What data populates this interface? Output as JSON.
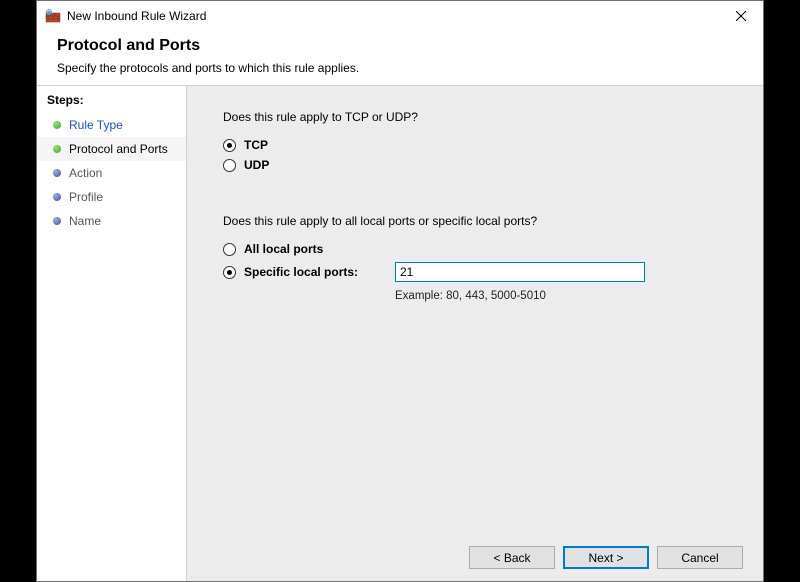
{
  "window": {
    "title": "New Inbound Rule Wizard"
  },
  "header": {
    "title": "Protocol and Ports",
    "subtitle": "Specify the protocols and ports to which this rule applies."
  },
  "sidebar": {
    "title": "Steps:",
    "items": [
      {
        "label": "Rule Type",
        "state": "done",
        "link": true
      },
      {
        "label": "Protocol and Ports",
        "state": "current",
        "link": false
      },
      {
        "label": "Action",
        "state": "pending",
        "link": false
      },
      {
        "label": "Profile",
        "state": "pending",
        "link": false
      },
      {
        "label": "Name",
        "state": "pending",
        "link": false
      }
    ]
  },
  "main": {
    "protocol": {
      "question": "Does this rule apply to TCP or UDP?",
      "options": [
        {
          "id": "tcp",
          "label": "TCP",
          "selected": true
        },
        {
          "id": "udp",
          "label": "UDP",
          "selected": false
        }
      ]
    },
    "ports": {
      "question": "Does this rule apply to all local ports or specific local ports?",
      "options": [
        {
          "id": "all",
          "label": "All local ports",
          "selected": false
        },
        {
          "id": "specific",
          "label": "Specific local ports:",
          "selected": true
        }
      ],
      "value": "21",
      "example": "Example: 80, 443, 5000-5010"
    }
  },
  "footer": {
    "back": "< Back",
    "next": "Next >",
    "cancel": "Cancel"
  }
}
